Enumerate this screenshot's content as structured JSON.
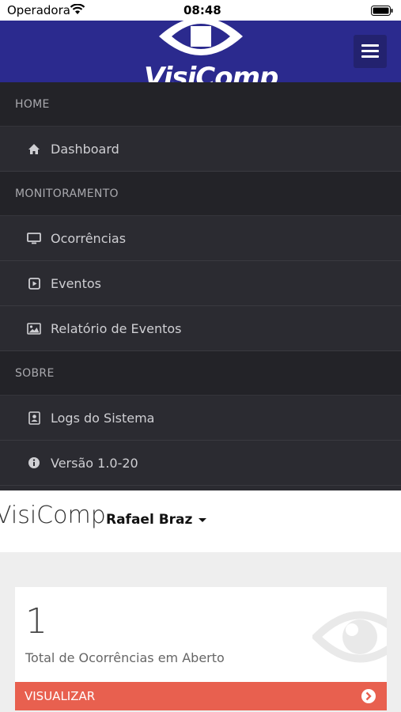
{
  "status_bar": {
    "carrier": "Operadora",
    "time": "08:48"
  },
  "header": {
    "logo_text": "VisiComp"
  },
  "nav": {
    "sections": [
      {
        "title": "HOME",
        "items": [
          {
            "label": "Dashboard",
            "icon": "home-icon"
          }
        ]
      },
      {
        "title": "MONITORAMENTO",
        "items": [
          {
            "label": "Ocorrências",
            "icon": "monitor-icon"
          },
          {
            "label": "Eventos",
            "icon": "play-square-icon"
          },
          {
            "label": "Relatório de Eventos",
            "icon": "image-icon"
          }
        ]
      },
      {
        "title": "SOBRE",
        "items": [
          {
            "label": "Logs do Sistema",
            "icon": "contact-card-icon"
          },
          {
            "label": "Versão 1.0-20",
            "icon": "info-icon"
          }
        ]
      }
    ]
  },
  "topbar": {
    "brand": "VisiComp",
    "user": "Rafael Braz"
  },
  "card": {
    "count": "1",
    "label": "Total de Ocorrências em Aberto",
    "footer": "VISUALIZAR"
  },
  "colors": {
    "header_bg": "#2b2a8e",
    "nav_bg": "#2b2b31",
    "accent": "#e8604f"
  }
}
